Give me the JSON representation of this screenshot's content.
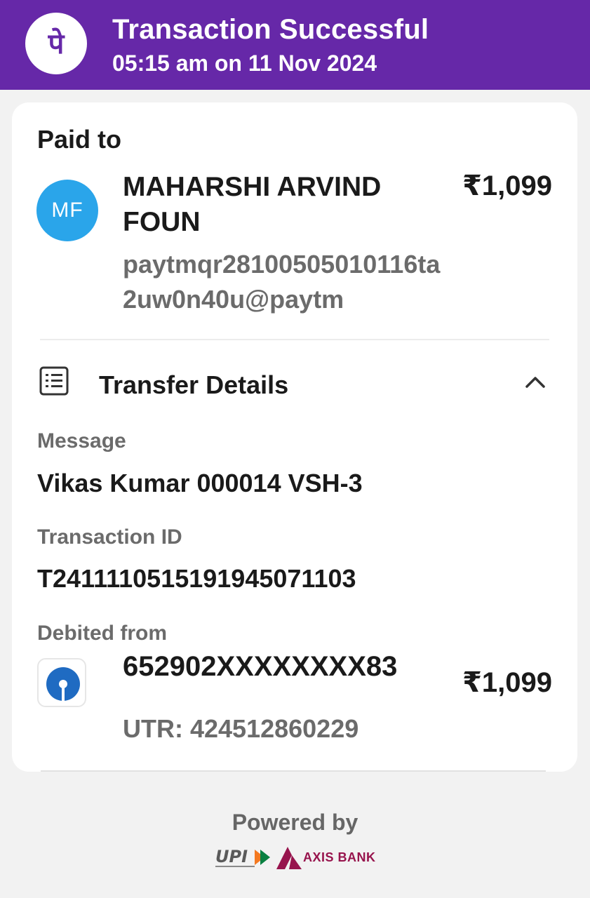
{
  "header": {
    "title": "Transaction Successful",
    "datetime": "05:15 am on 11 Nov 2024",
    "logo_glyph": "पे",
    "bg_color": "#6628a8"
  },
  "paid_to": {
    "heading": "Paid to",
    "avatar_initials": "MF",
    "avatar_color": "#2aa5ea",
    "name": "MAHARSHI ARVIND FOUN",
    "amount": "₹1,099",
    "vpa": "paytmqr28100505010116ta2uw0n40u@paytm"
  },
  "transfer_details": {
    "title": "Transfer Details",
    "icon": "list-icon",
    "toggle_icon": "chevron-up-icon",
    "message_label": "Message",
    "message_value": "Vikas Kumar 000014 VSH-3",
    "txn_label": "Transaction ID",
    "txn_value": "T2411110515191945071103",
    "debited_label": "Debited from",
    "bank_icon": "sbi-logo",
    "account": "652902XXXXXXXX83",
    "utr": "UTR: 424512860229",
    "amount": "₹1,099"
  },
  "footer": {
    "powered_by": "Powered by",
    "upi_logo_text": "UPI",
    "bank_name": "AXIS BANK"
  }
}
